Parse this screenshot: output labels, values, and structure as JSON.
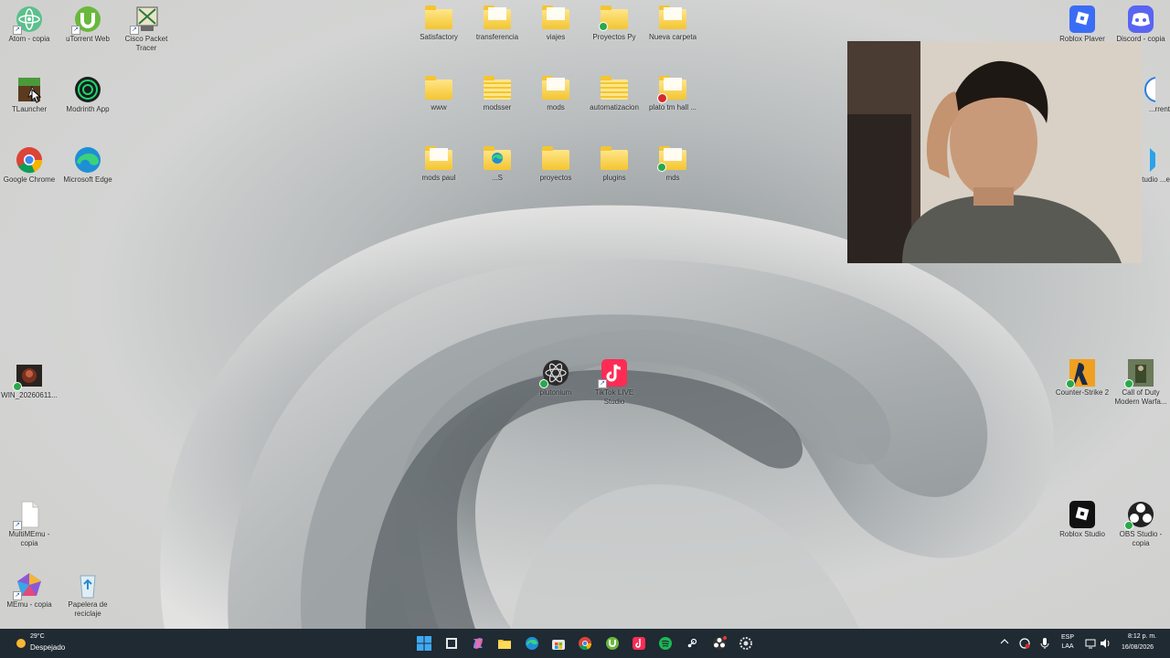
{
  "desktop": {
    "left_icons": [
      {
        "label": "Atom - copia",
        "icon": "atom-icon"
      },
      {
        "label": "uTorrent Web",
        "icon": "utorrent-icon"
      },
      {
        "label": "Cisco Packet Tracer",
        "icon": "cisco-packet-tracer-icon"
      },
      {
        "label": "TLauncher",
        "icon": "tlauncher-icon"
      },
      {
        "label": "Modrinth App",
        "icon": "modrinth-icon"
      },
      {
        "label": "Google Chrome",
        "icon": "chrome-icon"
      },
      {
        "label": "Microsoft Edge",
        "icon": "edge-icon"
      },
      {
        "label": "WIN_20260611...",
        "icon": "video-file-icon"
      },
      {
        "label": "MultiMEmu - copia",
        "icon": "text-file-icon"
      },
      {
        "label": "MEmu - copia",
        "icon": "memu-icon"
      },
      {
        "label": "Papelera de reciclaje",
        "icon": "recycle-bin-icon"
      }
    ],
    "folders": [
      {
        "label": "Satisfactory",
        "style": "plain"
      },
      {
        "label": "transferencia",
        "style": "paper"
      },
      {
        "label": "viajes",
        "style": "white"
      },
      {
        "label": "Proyectos Py",
        "style": "plain"
      },
      {
        "label": "Nueva carpeta",
        "style": "paper"
      },
      {
        "label": "www",
        "style": "plain"
      },
      {
        "label": "modsser",
        "style": "striped"
      },
      {
        "label": "mods",
        "style": "paper"
      },
      {
        "label": "automatizacion",
        "style": "striped"
      },
      {
        "label": "plato tm hall ...",
        "style": "paper"
      },
      {
        "label": "mods paul",
        "style": "paper"
      },
      {
        "label": "...S",
        "style": "edge"
      },
      {
        "label": "proyectos",
        "style": "plain"
      },
      {
        "label": "plugins",
        "style": "plain"
      },
      {
        "label": "mds",
        "style": "paper"
      }
    ],
    "center_icons": [
      {
        "label": "plutonium",
        "icon": "plutonium-icon"
      },
      {
        "label": "TikTok LIVE Studio",
        "icon": "tiktok-live-icon"
      }
    ],
    "right_icons": [
      {
        "label": "Roblox Player",
        "icon": "roblox-player-icon"
      },
      {
        "label": "Discord - copia",
        "icon": "discord-icon"
      },
      {
        "label": "...rrent",
        "icon": "torrent-icon"
      },
      {
        "label": "...Studio ...e",
        "icon": "studio-icon"
      },
      {
        "label": "Counter-Strike 2",
        "icon": "counter-strike-icon"
      },
      {
        "label": "Call of Duty Modern Warfa...",
        "icon": "call-of-duty-icon"
      },
      {
        "label": "Roblox Studio",
        "icon": "roblox-studio-icon"
      },
      {
        "label": "OBS Studio - copia",
        "icon": "obs-icon"
      }
    ]
  },
  "taskbar": {
    "weather": {
      "temp": "29°C",
      "desc": "Despejado",
      "icon": "sun-icon"
    },
    "apps": [
      "windows-start-icon",
      "task-view-icon",
      "copilot-icon",
      "file-explorer-icon",
      "edge-icon",
      "microsoft-store-icon",
      "chrome-icon",
      "utorrent-icon",
      "tiktok-icon",
      "spotify-icon",
      "steam-icon",
      "obs-icon",
      "settings-icon"
    ],
    "tray": {
      "lang_top": "ESP",
      "lang_bottom": "LAA",
      "time": "8:12 p. m.",
      "date": "16/08/2026"
    }
  },
  "colors": {
    "taskbar_bg": "#1f2a33",
    "folder_yellow": "#f4c531",
    "accent_blue": "#0078d4"
  }
}
